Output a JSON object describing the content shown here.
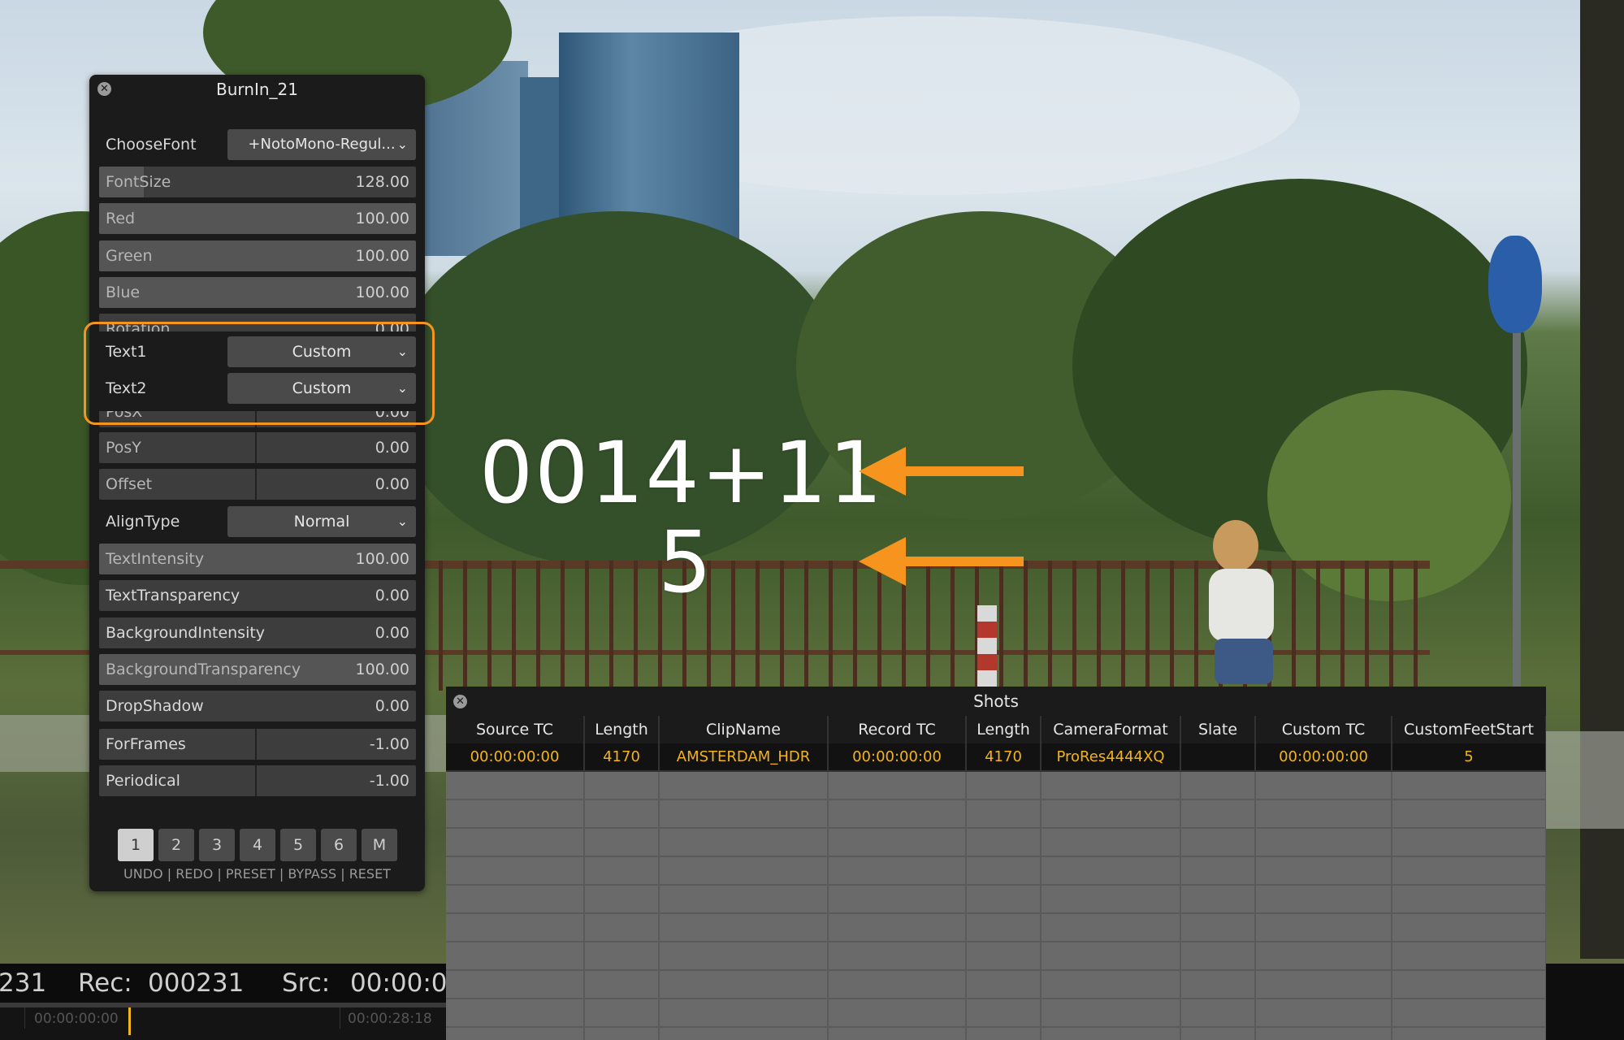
{
  "burnin_panel": {
    "title": "BurnIn_21",
    "choose_font": {
      "label": "ChooseFont",
      "value": "+NotoMono-Regul..."
    },
    "sliders_top": [
      {
        "name": "FontSize",
        "value": "128.00",
        "fill": 0.14
      },
      {
        "name": "Red",
        "value": "100.00",
        "fill": 1.0
      },
      {
        "name": "Green",
        "value": "100.00",
        "fill": 1.0
      },
      {
        "name": "Blue",
        "value": "100.00",
        "fill": 1.0
      },
      {
        "name": "Rotation",
        "value": "0.00",
        "fill": 0.0
      }
    ],
    "text1": {
      "label": "Text1",
      "value": "Custom"
    },
    "text2": {
      "label": "Text2",
      "value": "Custom"
    },
    "sliders_mid": [
      {
        "name": "PosX",
        "value": "0.00"
      },
      {
        "name": "PosY",
        "value": "0.00"
      },
      {
        "name": "Offset",
        "value": "0.00"
      }
    ],
    "align_type": {
      "label": "AlignType",
      "value": "Normal"
    },
    "sliders_bottom": [
      {
        "name": "TextIntensity",
        "value": "100.00",
        "fill": 1.0
      },
      {
        "name": "TextTransparency",
        "value": "0.00",
        "fill": 0.0
      },
      {
        "name": "BackgroundIntensity",
        "value": "0.00",
        "fill": 0.0
      },
      {
        "name": "BackgroundTransparency",
        "value": "100.00",
        "fill": 1.0
      },
      {
        "name": "DropShadow",
        "value": "0.00",
        "fill": 0.0
      }
    ],
    "sliders_frames": [
      {
        "name": "ForFrames",
        "value": "-1.00"
      },
      {
        "name": "Periodical",
        "value": "-1.00"
      }
    ],
    "presets": [
      "1",
      "2",
      "3",
      "4",
      "5",
      "6",
      "M"
    ],
    "active_preset": "1",
    "actions": "UNDO | REDO | PRESET | BYPASS | RESET"
  },
  "burn_text": {
    "line1": "0014+11",
    "line2": "5"
  },
  "timecode_bar": {
    "left": "231",
    "rec_label": "Rec:",
    "rec_value": "000231",
    "src_label": "Src:",
    "src_value": "00:00:0"
  },
  "timeline": {
    "start": "00:00:00:00",
    "end": "00:00:28:18"
  },
  "shots_panel": {
    "title": "Shots",
    "columns": [
      "Source TC",
      "Length",
      "ClipName",
      "Record TC",
      "Length",
      "CameraFormat",
      "Slate",
      "Custom TC",
      "CustomFeetStart"
    ],
    "rows": [
      [
        "00:00:00:00",
        "4170",
        "AMSTERDAM_HDR",
        "00:00:00:00",
        "4170",
        "ProRes4444XQ",
        "",
        "00:00:00:00",
        "5"
      ]
    ]
  },
  "colors": {
    "accent": "#f7941d",
    "value_text": "#f3b419"
  }
}
